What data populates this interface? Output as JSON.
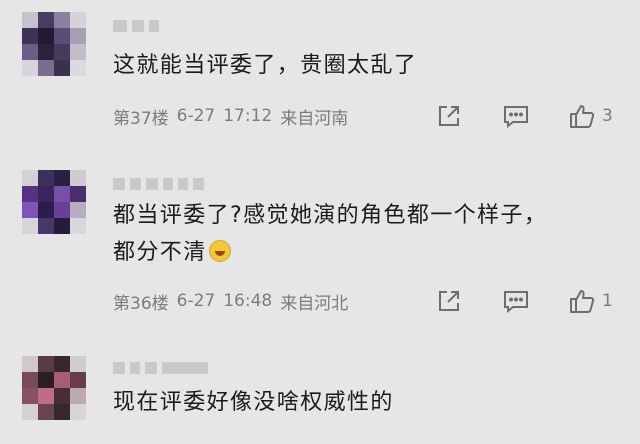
{
  "comments": [
    {
      "text_lines": [
        "这就能当评委了，贵圈太乱了"
      ],
      "floor": "第37楼",
      "date": "6-27",
      "time": "17:12",
      "location": "来自河南",
      "likes": "3",
      "icons": [
        "share-icon",
        "reply-icon",
        "thumb-up-icon"
      ]
    },
    {
      "text_lines": [
        "都当评委了?感觉她演的角色都一个样子，",
        "都分不清"
      ],
      "emoji": "laughing-crying-emoji",
      "floor": "第36楼",
      "date": "6-27",
      "time": "16:48",
      "location": "来自河北",
      "likes": "1",
      "icons": [
        "share-icon",
        "reply-icon",
        "thumb-up-icon"
      ]
    },
    {
      "text_lines": [
        "现在评委好像没啥权威性的"
      ]
    }
  ],
  "colors": {
    "background": "#e6e6e6",
    "text": "#1b1b1b",
    "meta": "#7c7c7c",
    "icon": "#6e6e6e"
  }
}
